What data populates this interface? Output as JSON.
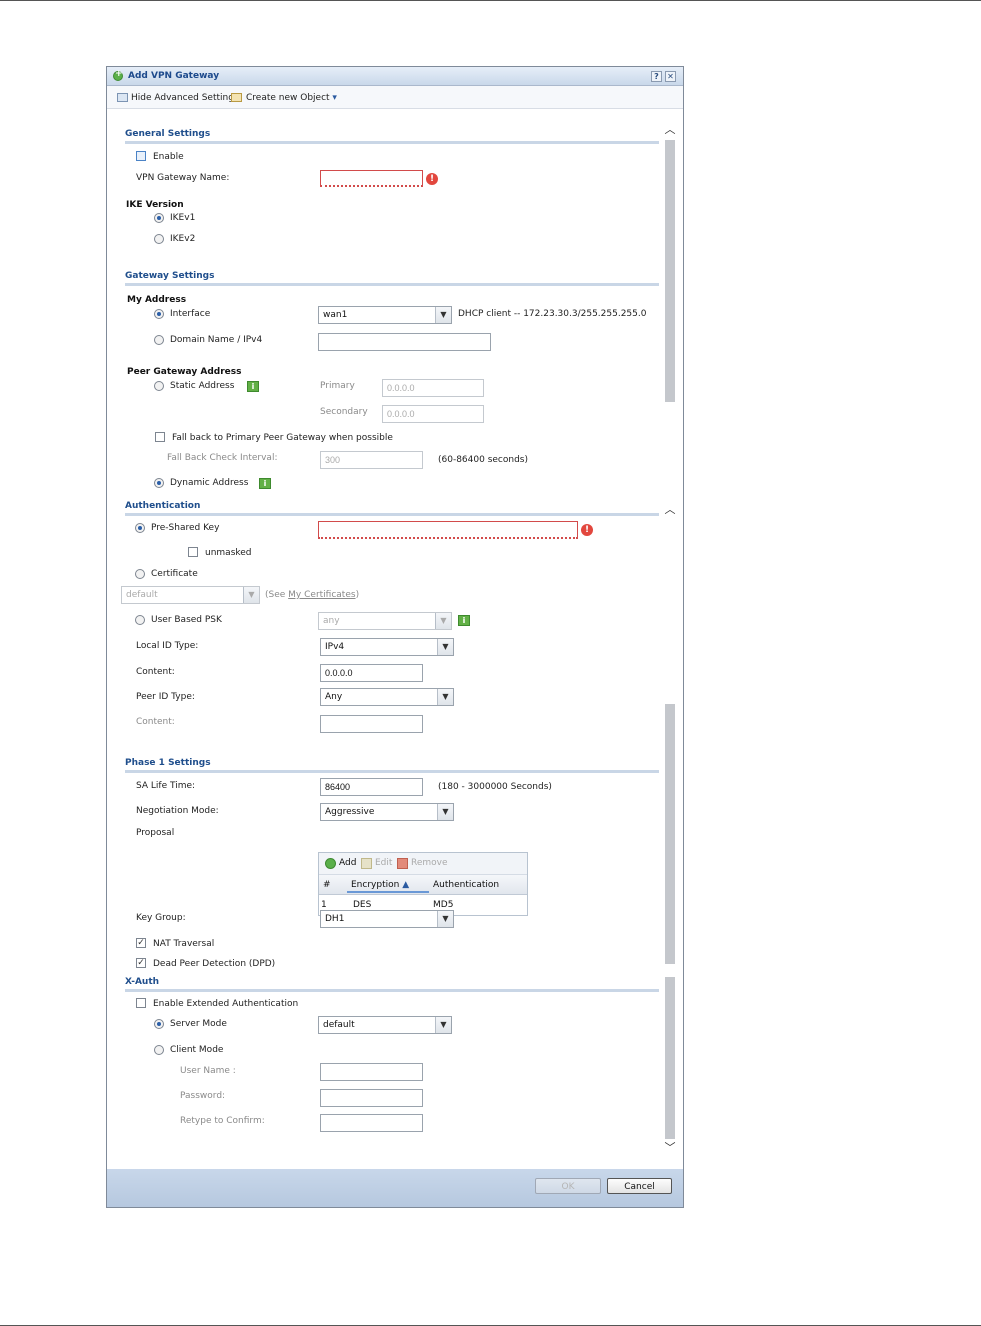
{
  "dialog": {
    "title": "Add VPN Gateway",
    "help_label": "?",
    "close_label": "✕"
  },
  "toolbar": {
    "hide_advanced_label": "Hide Advanced Settings",
    "create_object_label": "Create new Object"
  },
  "general": {
    "header": "General Settings",
    "enable_label": "Enable",
    "enable_checked": false,
    "name_label": "VPN Gateway Name:",
    "name_value": "",
    "ike_version_label": "IKE Version",
    "ikev1_label": "IKEv1",
    "ikev2_label": "IKEv2",
    "ike_selected": "IKEv1"
  },
  "gateway": {
    "header": "Gateway Settings",
    "my_address_label": "My Address",
    "interface_label": "Interface",
    "interface_value": "wan1",
    "interface_info": "DHCP client -- 172.23.30.3/255.255.255.0",
    "domain_label": "Domain Name / IPv4",
    "domain_value": "",
    "peer_label": "Peer Gateway Address",
    "static_label": "Static Address",
    "primary_label": "Primary",
    "primary_value": "0.0.0.0",
    "secondary_label": "Secondary",
    "secondary_value": "0.0.0.0",
    "fallback_label": "Fall back to Primary Peer Gateway when possible",
    "fallback_interval_label": "Fall Back Check Interval:",
    "fallback_interval_value": "300",
    "fallback_interval_hint": "(60-86400 seconds)",
    "dynamic_label": "Dynamic Address",
    "peer_selected": "Dynamic Address"
  },
  "auth": {
    "header": "Authentication",
    "psk_label": "Pre-Shared Key",
    "psk_value": "",
    "unmasked_label": "unmasked",
    "cert_label": "Certificate",
    "cert_value": "default",
    "cert_hint_prefix": "(See ",
    "cert_hint_link": "My Certificates",
    "cert_hint_suffix": ")",
    "user_psk_label": "User Based PSK",
    "user_psk_value": "any",
    "local_id_label": "Local ID Type:",
    "local_id_value": "IPv4",
    "local_content_label": "Content:",
    "local_content_value": "0.0.0.0",
    "peer_id_label": "Peer ID Type:",
    "peer_id_value": "Any",
    "peer_content_label": "Content:",
    "peer_content_value": "",
    "selected": "Pre-Shared Key"
  },
  "phase1": {
    "header": "Phase 1 Settings",
    "sa_life_label": "SA Life Time:",
    "sa_life_value": "86400",
    "sa_life_hint": "(180 - 3000000 Seconds)",
    "negotiation_label": "Negotiation Mode:",
    "negotiation_value": "Aggressive",
    "proposal_label": "Proposal",
    "proposal_toolbar": {
      "add": "Add",
      "edit": "Edit",
      "remove": "Remove"
    },
    "proposal_columns": [
      "#",
      "Encryption",
      "Authentication"
    ],
    "proposal_rows": [
      {
        "num": "1",
        "encryption": "DES",
        "authentication": "MD5"
      }
    ],
    "key_group_label": "Key Group:",
    "key_group_value": "DH1",
    "nat_label": "NAT Traversal",
    "nat_checked": true,
    "dpd_label": "Dead Peer Detection (DPD)",
    "dpd_checked": true
  },
  "xauth": {
    "header": "X-Auth",
    "enable_label": "Enable Extended Authentication",
    "enable_checked": false,
    "server_label": "Server Mode",
    "server_value": "default",
    "client_label": "Client Mode",
    "mode_selected": "Server Mode",
    "username_label": "User Name :",
    "password_label": "Password:",
    "retype_label": "Retype to Confirm:"
  },
  "footer": {
    "ok_label": "OK",
    "cancel_label": "Cancel"
  },
  "colors": {
    "header_text": "#1f4e8c",
    "invalid_border": "#d24b4b",
    "info_green": "#62b046",
    "footer_bg": "#c8d7ea"
  }
}
